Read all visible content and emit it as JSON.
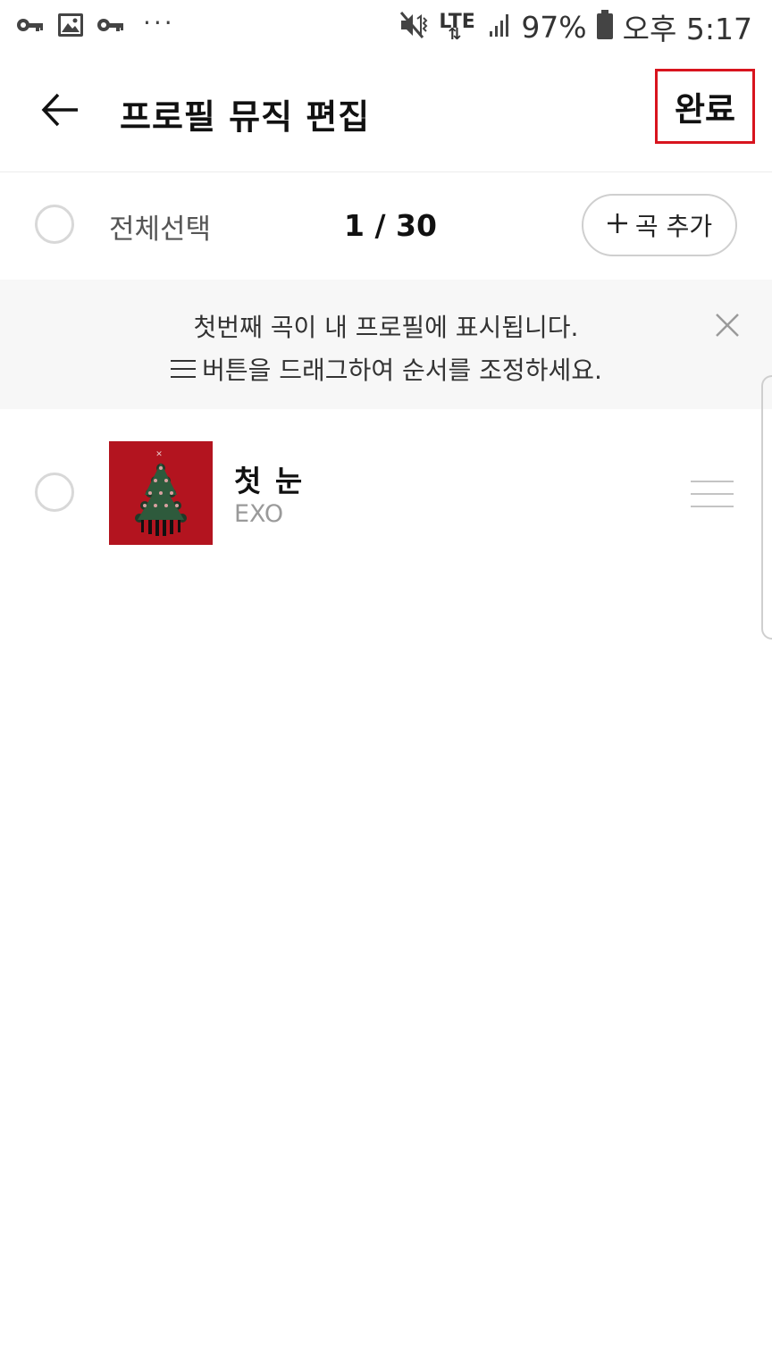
{
  "status_bar": {
    "network_label": "LTE",
    "battery": "97%",
    "time": "오후 5:17",
    "overflow": "···",
    "left_icons": [
      "vpn-key-icon",
      "image-icon",
      "vpn-key-icon",
      "more-dots-icon"
    ],
    "right_icons": [
      "mute-vibrate-icon",
      "lte-icon",
      "signal-icon",
      "battery-icon"
    ]
  },
  "header": {
    "title": "프로필 뮤직 편집",
    "back_icon": "arrow-left-icon",
    "done_label": "완료",
    "done_highlight_color": "#d8141e"
  },
  "select_row": {
    "select_all_label": "전체선택",
    "count": "1 / 30",
    "add_button_label": "곡 추가",
    "add_button_icon": "plus-icon"
  },
  "banner": {
    "line1": "첫번째 곡이 내 프로필에 표시됩니다.",
    "line2": "버튼을 드래그하여 순서를 조정하세요.",
    "line2_icon": "drag-handle-icon",
    "close_icon": "close-icon"
  },
  "songs": [
    {
      "title": "첫 눈",
      "artist": "EXO",
      "selected": false,
      "album_art_color": "#b3141f",
      "drag_icon": "drag-handle-icon"
    }
  ]
}
